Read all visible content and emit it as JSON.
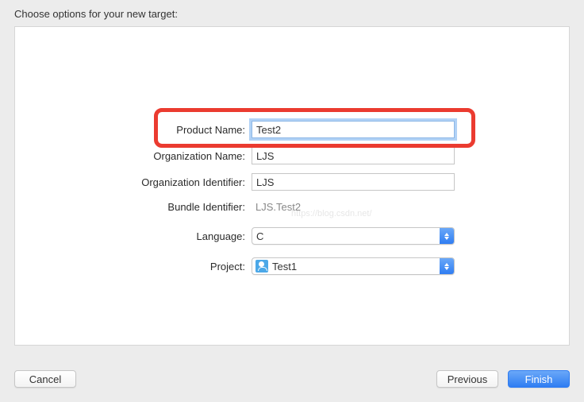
{
  "heading": "Choose options for your new target:",
  "form": {
    "product_name": {
      "label": "Product Name:",
      "value": "Test2"
    },
    "organization_name": {
      "label": "Organization Name:",
      "value": "LJS"
    },
    "organization_identifier": {
      "label": "Organization Identifier:",
      "value": "LJS"
    },
    "bundle_identifier": {
      "label": "Bundle Identifier:",
      "value": "LJS.Test2"
    },
    "language": {
      "label": "Language:",
      "value": "C"
    },
    "project": {
      "label": "Project:",
      "value": "Test1"
    }
  },
  "buttons": {
    "cancel": "Cancel",
    "previous": "Previous",
    "finish": "Finish"
  },
  "watermark": "https://blog.csdn.net/"
}
